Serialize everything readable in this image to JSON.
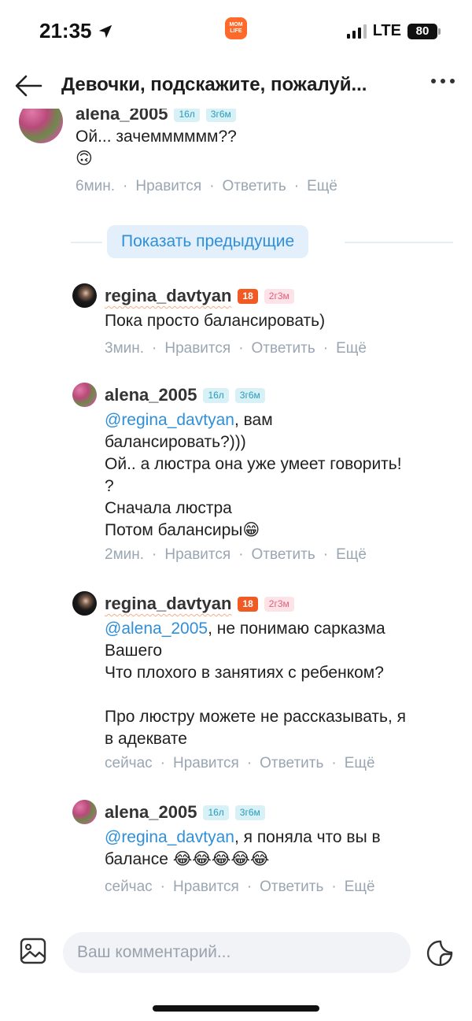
{
  "status_bar": {
    "time": "21:35",
    "network": "LTE",
    "battery": "80",
    "app_logo_text": "MOM LIFE"
  },
  "header": {
    "title": "Девочки, подскажите, пожалуй..."
  },
  "top_comment": {
    "username": "alena_2005",
    "badges": [
      "16л",
      "3г6м"
    ],
    "text": "Ой... зачемммммм??",
    "emoji": "🙃",
    "meta": {
      "time": "6мин.",
      "like": "Нравится",
      "reply": "Ответить",
      "more": "Ещё"
    }
  },
  "show_previous": {
    "label": "Показать предыдущие"
  },
  "replies": [
    {
      "username": "regina_davtyan",
      "badges": [
        "18",
        "2г3м"
      ],
      "mention": "",
      "text": "Пока просто балансировать)",
      "meta": {
        "time": "3мин.",
        "like": "Нравится",
        "reply": "Ответить",
        "more": "Ещё"
      }
    },
    {
      "username": "alena_2005",
      "badges": [
        "16л",
        "3г6м"
      ],
      "mention": "@regina_davtyan",
      "text": ", вам\nбалансировать?)))\nОй.. а люстра она уже умеет говорить!\n?\nСначала люстра\nПотом балансиры😁",
      "meta": {
        "time": "2мин.",
        "like": "Нравится",
        "reply": "Ответить",
        "more": "Ещё"
      }
    },
    {
      "username": "regina_davtyan",
      "badges": [
        "18",
        "2г3м"
      ],
      "mention": "@alena_2005",
      "text": ", не понимаю сарказма\nВашего\nЧто плохого в занятиях с ребенком?\n\nПро люстру можете не рассказывать, я\nв адеквате",
      "meta": {
        "time": "сейчас",
        "like": "Нравится",
        "reply": "Ответить",
        "more": "Ещё"
      }
    },
    {
      "username": "alena_2005",
      "badges": [
        "16л",
        "3г6м"
      ],
      "mention": "@regina_davtyan",
      "text": ", я поняла что вы в\nбалансе 😂😂😂😂😂",
      "meta": {
        "time": "сейчас",
        "like": "Нравится",
        "reply": "Ответить",
        "more": "Ещё"
      }
    }
  ],
  "input": {
    "placeholder": "Ваш комментарий..."
  },
  "colors": {
    "accent": "#2f8fd8",
    "badge_orange": "#f25a23",
    "meta_gray": "#9aa6b2"
  }
}
